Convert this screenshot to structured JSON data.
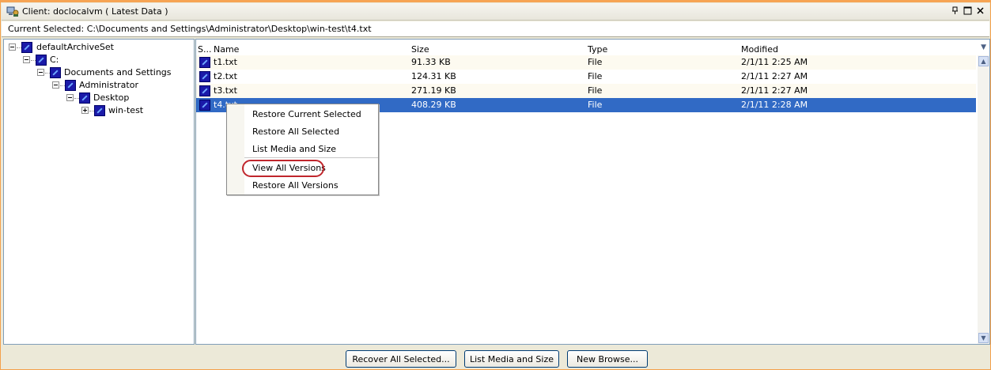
{
  "window": {
    "title": "Client: doclocalvm ( Latest Data )"
  },
  "path": {
    "text": "Current Selected: C:\\Documents and Settings\\Administrator\\Desktop\\win-test\\t4.txt"
  },
  "tree": {
    "items": [
      {
        "label": "defaultArchiveSet",
        "expander": "minus"
      },
      {
        "label": "C:",
        "expander": "minus"
      },
      {
        "label": "Documents and Settings",
        "expander": "minus"
      },
      {
        "label": "Administrator",
        "expander": "minus"
      },
      {
        "label": "Desktop",
        "expander": "minus"
      },
      {
        "label": "win-test",
        "expander": "plus"
      }
    ]
  },
  "list": {
    "columns": {
      "select": "S...",
      "name": "Name",
      "size": "Size",
      "type": "Type",
      "modified": "Modified"
    },
    "rows": [
      {
        "name": "t1.txt",
        "size": "91.33 KB",
        "type": "File",
        "modified": "2/1/11 2:25 AM"
      },
      {
        "name": "t2.txt",
        "size": "124.31 KB",
        "type": "File",
        "modified": "2/1/11 2:27 AM"
      },
      {
        "name": "t3.txt",
        "size": "271.19 KB",
        "type": "File",
        "modified": "2/1/11 2:27 AM"
      },
      {
        "name": "t4.txt",
        "size": "408.29 KB",
        "type": "File",
        "modified": "2/1/11 2:28 AM",
        "selected": true
      }
    ]
  },
  "context_menu": {
    "items": [
      "Restore Current Selected",
      "Restore All Selected",
      "List Media and Size",
      "View All Versions",
      "Restore All Versions"
    ],
    "highlighted": "View All Versions"
  },
  "buttons": {
    "recover": "Recover All Selected...",
    "list_media": "List Media and Size",
    "new_browse": "New Browse..."
  },
  "colors": {
    "selection": "#316ac5",
    "accent_border": "#f6a454",
    "highlight_ring": "#c0262c"
  }
}
